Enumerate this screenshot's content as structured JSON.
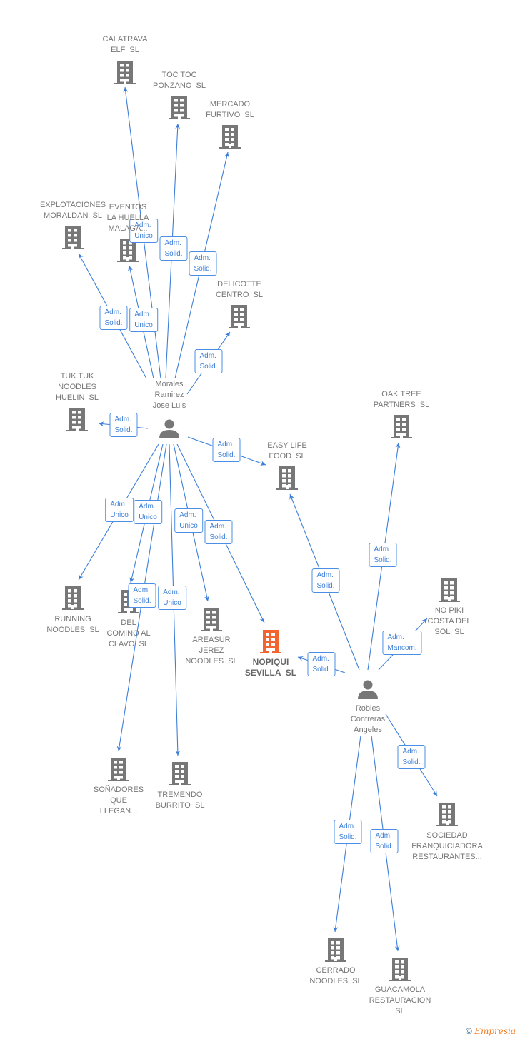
{
  "colors": {
    "edge": "#3d7fd8",
    "company": "#777777",
    "highlight": "#f26430",
    "person": "#777777"
  },
  "nodes": [
    {
      "id": "calatrava",
      "type": "company",
      "label": "CALATRAVA\nELF  SL"
    },
    {
      "id": "toc",
      "type": "company",
      "label": "TOC TOC\nPONZANO  SL"
    },
    {
      "id": "mercado",
      "type": "company",
      "label": "MERCADO\nFURTIVO  SL"
    },
    {
      "id": "explotaciones",
      "type": "company",
      "label": "EXPLOTACIONES\nMORALDAN  SL"
    },
    {
      "id": "eventos",
      "type": "company",
      "label": "EVENTOS\nLA HUELLA\nMALAGA..."
    },
    {
      "id": "delicotte",
      "type": "company",
      "label": "DELICOTTE\nCENTRO  SL"
    },
    {
      "id": "tuk",
      "type": "company",
      "label": "TUK TUK\nNOODLES\nHUELIN  SL"
    },
    {
      "id": "morales",
      "type": "person",
      "label": "Morales\nRamirez\nJose Luis"
    },
    {
      "id": "oak",
      "type": "company",
      "label": "OAK TREE\nPARTNERS  SL"
    },
    {
      "id": "easy",
      "type": "company",
      "label": "EASY LIFE\nFOOD  SL"
    },
    {
      "id": "nopiki",
      "type": "company",
      "label": "NO PIKI\nCOSTA DEL\nSOL  SL"
    },
    {
      "id": "running",
      "type": "company",
      "label": "RUNNING\nNOODLES  SL"
    },
    {
      "id": "delcomino",
      "type": "company",
      "label": "DEL\nCOMINO AL\nCLAVO  SL"
    },
    {
      "id": "areasur",
      "type": "company",
      "label": "AREASUR\nJEREZ\nNOODLES  SL"
    },
    {
      "id": "nopiqui",
      "type": "main",
      "label": "NOPIQUI\nSEVILLA  SL"
    },
    {
      "id": "robles",
      "type": "person",
      "label": "Robles\nContreras\nAngeles"
    },
    {
      "id": "sonadores",
      "type": "company",
      "label": "SOÑADORES\nQUE\nLLEGAN..."
    },
    {
      "id": "tremendo",
      "type": "company",
      "label": "TREMENDO\nBURRITO  SL"
    },
    {
      "id": "sociedad",
      "type": "company",
      "label": "SOCIEDAD\nFRANQUICIADORA\nRESTAURANTES..."
    },
    {
      "id": "cerrado",
      "type": "company",
      "label": "CERRADO\nNOODLES  SL"
    },
    {
      "id": "guacamola",
      "type": "company",
      "label": "GUACAMOLA\nRESTAURACION\nSL"
    }
  ],
  "edges": [
    {
      "from": "morales",
      "to": "calatrava",
      "label": "Adm.\nUnico"
    },
    {
      "from": "morales",
      "to": "toc",
      "label": "Adm.\nSolid."
    },
    {
      "from": "morales",
      "to": "mercado",
      "label": "Adm.\nSolid."
    },
    {
      "from": "morales",
      "to": "explotaciones",
      "label": "Adm.\nSolid."
    },
    {
      "from": "morales",
      "to": "eventos",
      "label": "Adm.\nUnico"
    },
    {
      "from": "morales",
      "to": "delicotte",
      "label": "Adm.\nSolid."
    },
    {
      "from": "morales",
      "to": "tuk",
      "label": "Adm.\nSolid."
    },
    {
      "from": "morales",
      "to": "easy",
      "label": "Adm.\nSolid."
    },
    {
      "from": "morales",
      "to": "running",
      "label": "Adm.\nUnico"
    },
    {
      "from": "morales",
      "to": "delcomino",
      "label": "Adm.\nUnico"
    },
    {
      "from": "morales",
      "to": "sonadores",
      "label": "Adm.\nSolid."
    },
    {
      "from": "morales",
      "to": "tremendo",
      "label": "Adm.\nUnico"
    },
    {
      "from": "morales",
      "to": "areasur",
      "label": "Adm.\nUnico"
    },
    {
      "from": "morales",
      "to": "nopiqui",
      "label": "Adm.\nSolid."
    },
    {
      "from": "robles",
      "to": "easy",
      "label": "Adm.\nSolid."
    },
    {
      "from": "robles",
      "to": "oak",
      "label": "Adm.\nSolid."
    },
    {
      "from": "robles",
      "to": "nopiki",
      "label": "Adm.\nMancom."
    },
    {
      "from": "robles",
      "to": "nopiqui",
      "label": "Adm.\nSolid."
    },
    {
      "from": "robles",
      "to": "sociedad",
      "label": "Adm.\nSolid."
    },
    {
      "from": "robles",
      "to": "cerrado",
      "label": "Adm.\nSolid."
    },
    {
      "from": "robles",
      "to": "guacamola",
      "label": "Adm.\nSolid."
    }
  ],
  "footer": {
    "copyright": "©",
    "brand": "Empresia"
  }
}
